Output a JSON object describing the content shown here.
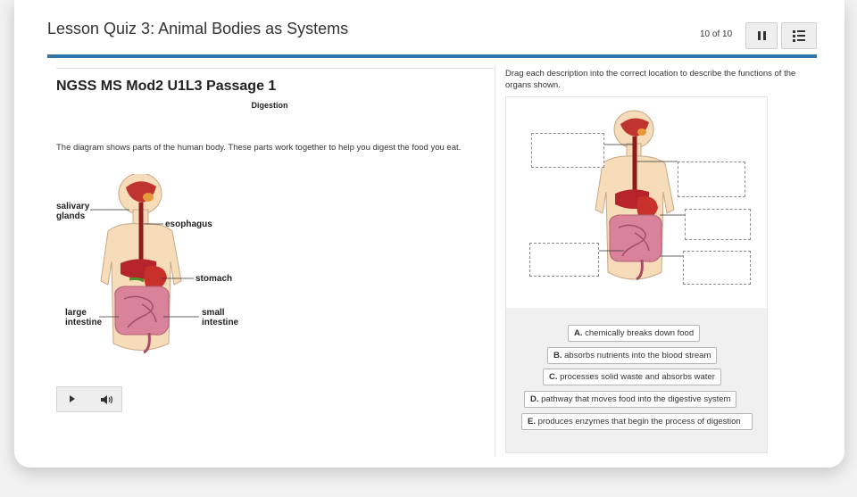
{
  "header": {
    "title": "Lesson Quiz 3: Animal Bodies as Systems",
    "counter": "10 of 10",
    "pause_icon": "pause-icon",
    "list_icon": "list-icon"
  },
  "passage": {
    "title": "NGSS MS Mod2 U1L3 Passage 1",
    "subtitle": "Digestion",
    "text": "The diagram shows parts of the human body. These parts work together to help you digest the food you eat.",
    "diagram_labels": {
      "salivary": "salivary",
      "glands": "glands",
      "esophagus": "esophagus",
      "stomach": "stomach",
      "large": "large",
      "intestine_large": "intestine",
      "small": "small",
      "intestine_small": "intestine"
    }
  },
  "audio": {
    "play_icon": "play-icon",
    "volume_icon": "volume-icon"
  },
  "question": {
    "instruction": "Drag each description into the correct location to describe the functions of the organs shown.",
    "options": [
      {
        "letter": "A.",
        "text": "chemically breaks down food"
      },
      {
        "letter": "B.",
        "text": "absorbs nutrients into the blood stream"
      },
      {
        "letter": "C.",
        "text": "processes solid waste and absorbs water"
      },
      {
        "letter": "D.",
        "text": "pathway that moves food into the digestive system"
      },
      {
        "letter": "E.",
        "text": "produces enzymes that begin the process of digestion"
      }
    ]
  },
  "colors": {
    "accent": "#2f74ab",
    "skin": "#f6dcb9",
    "organ_red": "#b5232b",
    "intestine_pink": "#d9839a"
  }
}
